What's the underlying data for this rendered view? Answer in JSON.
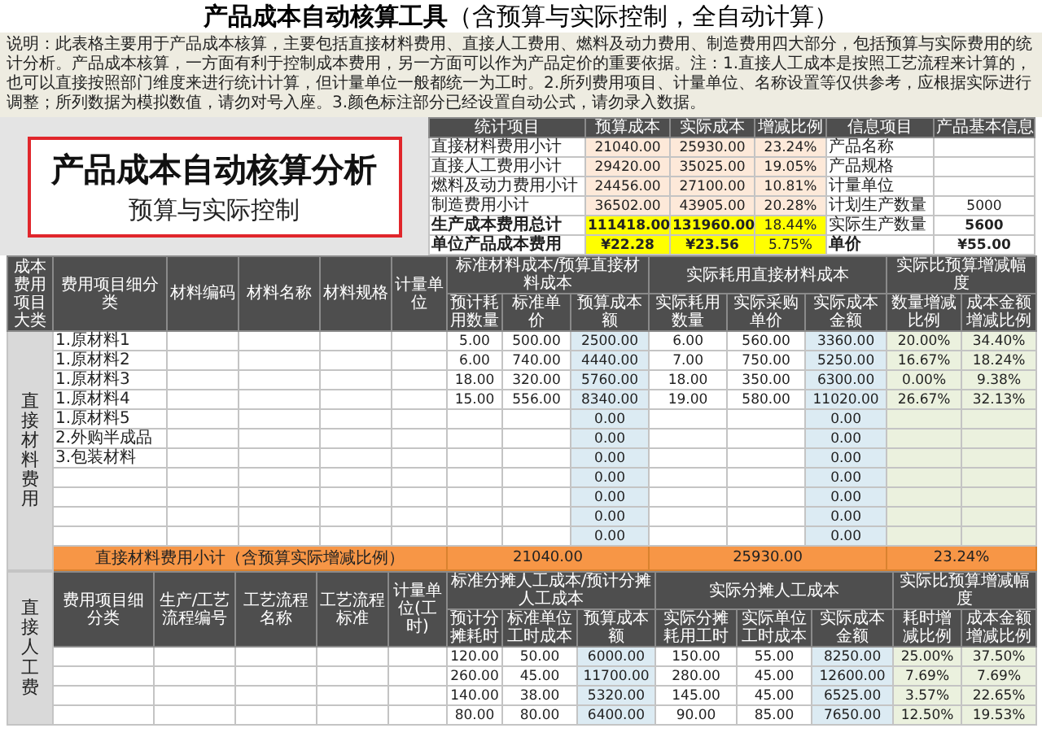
{
  "title": "**产品成本自动核算工具**（含预算与实际控制，全自动计算）",
  "description": "说明：此表格主要用于产品成本核算，主要包括直接材料费用、直接人工费用、燃料及动力费用、制造费用四大部分，包括预算与实际费用的统计分析。产品成本核算，一方面有利于控制成本费用，另一方面可以作为产品定价的重要依据。注：1.直接人工成本是按照工艺流程来计算的，也可以直接按照部门维度来进行统计计算，但计量单位一般都统一为工时。2.所列费用项目、计量单位、名称设置等仅供参考，应根据实际进行调整；所列数据为模拟数值，请勿对号入座。3.颜色标注部分已经设置自动公式，请勿录入数据。",
  "banner": {
    "title": "产品成本自动核算分析",
    "subtitle": "预算与实际控制"
  },
  "summary": {
    "columns": [
      "统计项目",
      "预算成本",
      "实际成本",
      "增减比例",
      "信息项目",
      "产品基本信息"
    ],
    "rows": [
      {
        "item": "直接材料费用小计",
        "budget": "21040.00",
        "actual": "25930.00",
        "ratio": "23.24%",
        "info_item": "产品名称",
        "emphasis": false
      },
      {
        "item": "直接人工费用小计",
        "budget": "29420.00",
        "actual": "35025.00",
        "ratio": "19.05%",
        "info_item": "产品规格",
        "emphasis": false
      },
      {
        "item": "燃料及动力费用小计",
        "budget": "24456.00",
        "actual": "27100.00",
        "ratio": "10.81%",
        "info_item": "计量单位",
        "emphasis": false
      },
      {
        "item": "制造费用小计",
        "budget": "36502.00",
        "actual": "43905.00",
        "ratio": "20.28%",
        "info_item": "计划生产数量",
        "info_value": "5000",
        "emphasis": false
      },
      {
        "item": "生产成本费用总计",
        "budget": "111418.00",
        "actual": "131960.00",
        "ratio": "18.44%",
        "info_item": "实际生产数量",
        "info_value": "5600",
        "emphasis": true
      },
      {
        "item": "单位产品成本费用",
        "budget": "¥22.28",
        "actual": "¥23.56",
        "ratio": "5.75%",
        "info_item": "单价",
        "info_value": "¥55.00",
        "emphasis": true
      }
    ]
  },
  "material": {
    "corner": "成本费用项目大类",
    "category": "直接材料费用",
    "headers": [
      {
        "label": "费用项目细分类"
      },
      {
        "label": "材料编码"
      },
      {
        "label": "材料名称"
      },
      {
        "label": "材料规格"
      },
      {
        "label": "计量单位"
      },
      {
        "label": "标准材料成本/预算直接材料成本",
        "children": [
          {
            "label": "预计耗用数量"
          },
          {
            "label": "标准单价"
          },
          {
            "label": "预算成本额",
            "color": "#dcebf3"
          }
        ]
      },
      {
        "label": "实际耗用直接材料成本",
        "children": [
          {
            "label": "实际耗用数量"
          },
          {
            "label": "实际采购单价"
          },
          {
            "label": "实际成本金额",
            "color": "#dcebf3"
          }
        ]
      },
      {
        "label": "实际比预算增减幅度",
        "children": [
          {
            "label": "数量增减比例",
            "color": "#ebf1de"
          },
          {
            "label": "成本金额增减比例",
            "color": "#ebf1de"
          }
        ]
      }
    ],
    "rows": [
      {
        "cells": [
          "1.原材料1",
          null,
          null,
          null,
          null,
          "5.00",
          "500.00",
          "2500.00",
          "6.00",
          "560.00",
          "3360.00",
          "20.00%",
          "34.40%"
        ]
      },
      {
        "cells": [
          "1.原材料2",
          null,
          null,
          null,
          null,
          "6.00",
          "740.00",
          "4440.00",
          "7.00",
          "750.00",
          "5250.00",
          "16.67%",
          "18.24%"
        ]
      },
      {
        "cells": [
          "1.原材料3",
          null,
          null,
          null,
          null,
          "18.00",
          "320.00",
          "5760.00",
          "18.00",
          "350.00",
          "6300.00",
          "0.00%",
          "9.38%"
        ]
      },
      {
        "cells": [
          "1.原材料4",
          null,
          null,
          null,
          null,
          "15.00",
          "556.00",
          "8340.00",
          "19.00",
          "580.00",
          "11020.00",
          "26.67%",
          "32.13%"
        ]
      },
      {
        "cells": [
          "1.原材料5",
          null,
          null,
          null,
          null,
          null,
          null,
          "0.00",
          null,
          null,
          "0.00",
          null,
          null
        ]
      },
      {
        "cells": [
          "2.外购半成品",
          null,
          null,
          null,
          null,
          null,
          null,
          "0.00",
          null,
          null,
          "0.00",
          null,
          null
        ]
      },
      {
        "cells": [
          "3.包装材料",
          null,
          null,
          null,
          null,
          null,
          null,
          "0.00",
          null,
          null,
          "0.00",
          null,
          null
        ]
      },
      {
        "cells": [
          null,
          null,
          null,
          null,
          null,
          null,
          null,
          "0.00",
          null,
          null,
          "0.00",
          null,
          null
        ]
      },
      {
        "cells": [
          null,
          null,
          null,
          null,
          null,
          null,
          null,
          "0.00",
          null,
          null,
          "0.00",
          null,
          null
        ]
      },
      {
        "cells": [
          null,
          null,
          null,
          null,
          null,
          null,
          null,
          "0.00",
          null,
          null,
          "0.00",
          null,
          null
        ]
      },
      {
        "cells": [
          null,
          null,
          null,
          null,
          null,
          null,
          null,
          "0.00",
          null,
          null,
          "0.00",
          null,
          null
        ]
      }
    ],
    "subtotal": {
      "label": "直接材料费用小计（含预算实际增减比例）",
      "budget": "21040.00",
      "actual": "25930.00",
      "change": "23.24%"
    }
  },
  "labor": {
    "category": "直接人工费",
    "headers": [
      {
        "label": "费用项目细分类"
      },
      {
        "label": "生产/工艺流程编号"
      },
      {
        "label": "工艺流程名称"
      },
      {
        "label": "工艺流程标准"
      },
      {
        "label": "计量单位(工时)"
      },
      {
        "label": "标准分摊人工成本/预计分摊人工成本",
        "children": [
          {
            "label": "预计分摊耗时"
          },
          {
            "label": "标准单位工时成本"
          },
          {
            "label": "预算成本额",
            "color": "#dcebf3"
          }
        ]
      },
      {
        "label": "实际分摊人工成本",
        "children": [
          {
            "label": "实际分摊耗用工时"
          },
          {
            "label": "实际单位工时成本"
          },
          {
            "label": "实际成本金额",
            "color": "#dcebf3"
          }
        ]
      },
      {
        "label": "实际比预算增减幅度",
        "children": [
          {
            "label": "耗时增减比例",
            "color": "#ebf1de"
          },
          {
            "label": "成本金额增减比例",
            "color": "#ebf1de"
          }
        ]
      }
    ],
    "rows": [
      {
        "cells": [
          null,
          null,
          null,
          null,
          null,
          "120.00",
          "50.00",
          "6000.00",
          "150.00",
          "55.00",
          "8250.00",
          "25.00%",
          "37.50%"
        ]
      },
      {
        "cells": [
          null,
          null,
          null,
          null,
          null,
          "260.00",
          "45.00",
          "11700.00",
          "280.00",
          "45.00",
          "12600.00",
          "7.69%",
          "7.69%"
        ]
      },
      {
        "cells": [
          null,
          null,
          null,
          null,
          null,
          "140.00",
          "38.00",
          "5320.00",
          "145.00",
          "45.00",
          "6525.00",
          "3.57%",
          "22.65%"
        ]
      },
      {
        "cells": [
          null,
          null,
          null,
          null,
          null,
          "80.00",
          "80.00",
          "6400.00",
          "90.00",
          "85.00",
          "7650.00",
          "12.50%",
          "19.53%"
        ]
      }
    ]
  }
}
